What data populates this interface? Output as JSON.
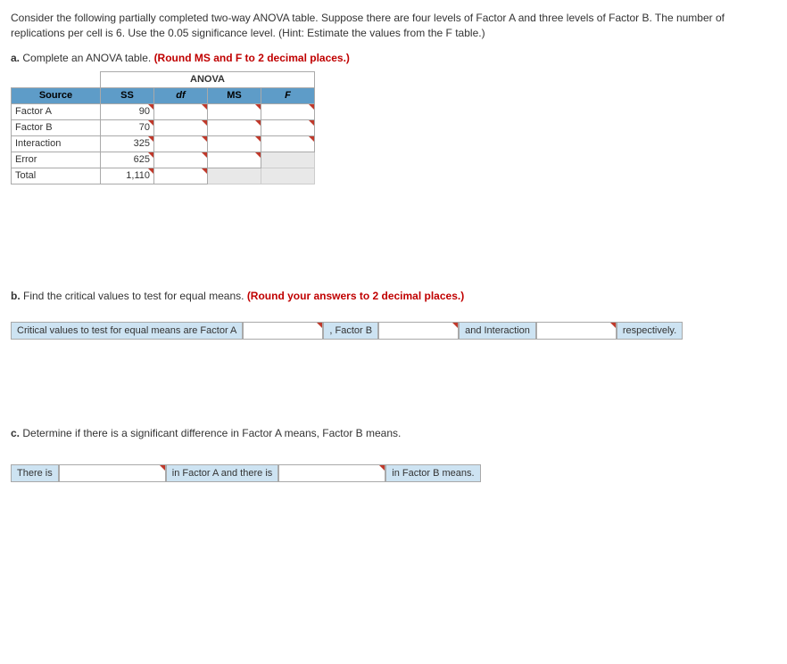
{
  "intro": "Consider the following partially completed two-way ANOVA table. Suppose there are four levels of Factor A and three levels of Factor B. The number of replications per cell is 6. Use the 0.05 significance level. (Hint: Estimate the values from the F table.)",
  "parts": {
    "a": {
      "label": "a.",
      "text": "Complete an ANOVA table.",
      "hint": "(Round MS and F to 2 decimal places.)"
    },
    "b": {
      "label": "b.",
      "text": "Find the critical values to test for equal means.",
      "hint": "(Round your answers to 2 decimal places.)"
    },
    "c": {
      "label": "c.",
      "text": "Determine if there is a significant difference in Factor A means, Factor B means."
    }
  },
  "anova": {
    "title": "ANOVA",
    "headers": {
      "source": "Source",
      "ss": "SS",
      "df": "df",
      "ms": "MS",
      "f": "F"
    },
    "rows": [
      {
        "source": "Factor A",
        "ss": "90"
      },
      {
        "source": "Factor B",
        "ss": "70"
      },
      {
        "source": "Interaction",
        "ss": "325"
      },
      {
        "source": "Error",
        "ss": "625"
      },
      {
        "source": "Total",
        "ss": "1,110"
      }
    ]
  },
  "critRow": {
    "lead": "Critical values to test for equal means are Factor A",
    "factorB": ", Factor B",
    "interaction": "and Interaction",
    "trail": "respectively."
  },
  "sigRow": {
    "lead": "There is",
    "mid": "in Factor A and there is",
    "trail": "in Factor B means."
  }
}
